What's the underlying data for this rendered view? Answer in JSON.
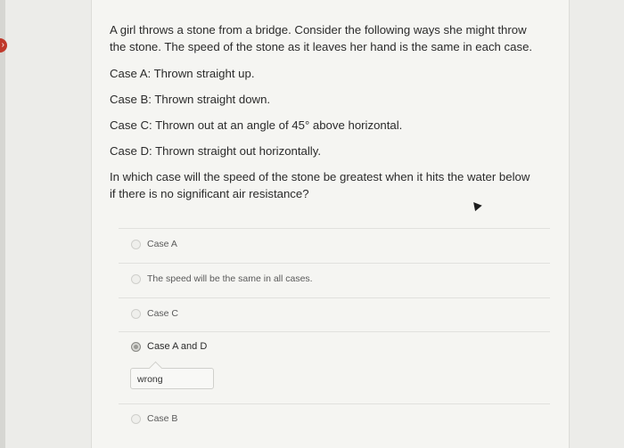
{
  "question": {
    "intro": "A girl throws a stone from a bridge. Consider the following ways she might throw the stone. The speed of the stone as it leaves her hand is the same in each case.",
    "case_a": "Case A: Thrown straight up.",
    "case_b": "Case B: Thrown straight down.",
    "case_c": "Case C: Thrown out at an angle of 45° above horizontal.",
    "case_d": "Case D: Thrown straight out horizontally.",
    "prompt": "In which case will the speed of the stone be greatest when it hits the water below if there is no significant air resistance?"
  },
  "options": [
    {
      "label": "Case A",
      "selected": false
    },
    {
      "label": "The speed will be the same in all cases.",
      "selected": false
    },
    {
      "label": "Case C",
      "selected": false
    },
    {
      "label": "Case A and D",
      "selected": true
    },
    {
      "label": "Case B",
      "selected": false
    }
  ],
  "feedback": {
    "text": "wrong"
  }
}
